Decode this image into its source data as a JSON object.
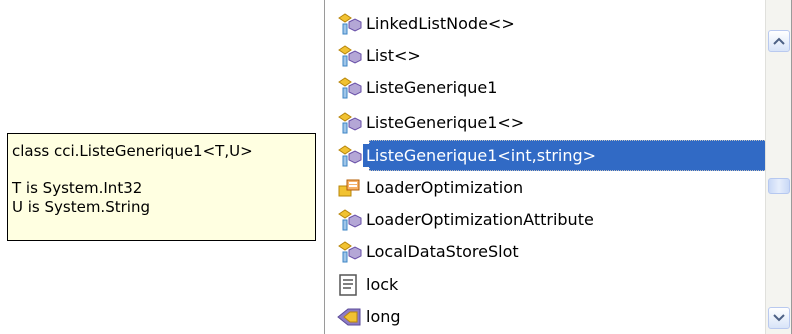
{
  "header_fragment": "",
  "tooltip": {
    "signature": "class cci.ListeGenerique1<T,U>",
    "lines": [
      "T is System.Int32",
      "U is System.String"
    ]
  },
  "list": {
    "items": [
      {
        "label": "LinkedListNode<>",
        "icon": "class-icon"
      },
      {
        "label": "List<>",
        "icon": "class-icon"
      },
      {
        "label": "ListeGenerique1",
        "icon": "class-icon"
      },
      {
        "label": "ListeGenerique1<>",
        "icon": "class-icon"
      },
      {
        "label": "ListeGenerique1<int,string>",
        "icon": "class-icon",
        "selected": true
      },
      {
        "label": "LoaderOptimization",
        "icon": "enum-icon"
      },
      {
        "label": "LoaderOptimizationAttribute",
        "icon": "class-icon"
      },
      {
        "label": "LocalDataStoreSlot",
        "icon": "class-icon"
      },
      {
        "label": "lock",
        "icon": "snippet-icon"
      },
      {
        "label": "long",
        "icon": "keyword-icon"
      }
    ]
  },
  "colors": {
    "selection": "#316ac5",
    "tooltip_bg": "#ffffe1"
  }
}
